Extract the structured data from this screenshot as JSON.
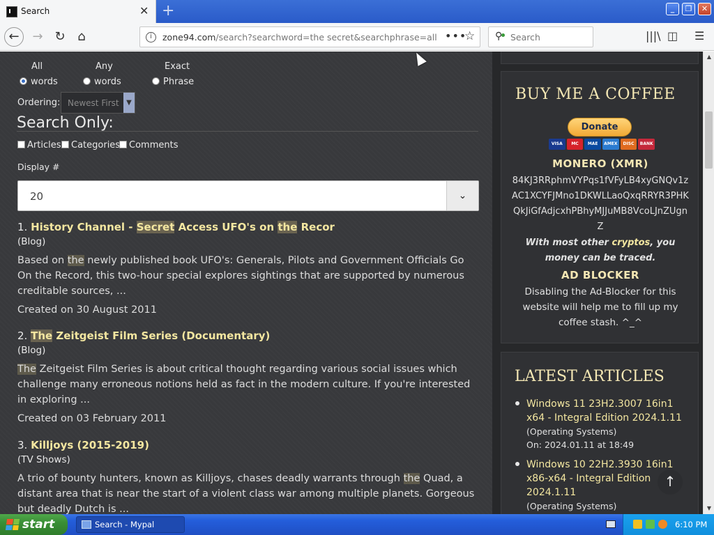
{
  "browser": {
    "tab_title": "Search",
    "tab_close": "✕",
    "new_tab": "+",
    "url_host": "zone94.com",
    "url_path": "/search?searchword=the secret&searchphrase=all",
    "search_placeholder": "Search",
    "window_controls": {
      "minimize": "_",
      "maximize": "❐",
      "close": "✕"
    }
  },
  "search_form": {
    "radios": [
      {
        "top": "All",
        "bottom": "words",
        "selected": true
      },
      {
        "top": "Any",
        "bottom": "words",
        "selected": false
      },
      {
        "top": "Exact",
        "bottom": "Phrase",
        "selected": false
      }
    ],
    "ordering_label": "Ordering:",
    "ordering_value": "Newest First",
    "search_only_heading": "Search Only:",
    "checkboxes": [
      "Articles",
      "Categories",
      "Comments"
    ],
    "display_label": "Display #",
    "display_value": "20"
  },
  "results": [
    {
      "number": "1.",
      "title_parts": [
        "History Channel",
        " - ",
        "Secret",
        " Access UFO's on ",
        "the",
        " Recor"
      ],
      "category": "(Blog)",
      "body_pre": "Based on ",
      "body_hl": "the",
      "body_post": " newly published book UFO's: Generals, Pilots and Government Officials Go On the Record, this two-hour special explores sightings that are supported by numerous creditable sources, ...",
      "date": "Created on 30 August 2011"
    },
    {
      "number": "2.",
      "title_hl": "The",
      "title_rest": " Zeitgeist Film Series (Documentary)",
      "category": "(Blog)",
      "body_hl": "The",
      "body_post": " Zeitgeist Film Series is about critical thought regarding various social issues which challenge many erroneous notions held as fact in the modern culture. If you're interested in exploring ...",
      "date": "Created on 03 February 2011"
    },
    {
      "number": "3.",
      "title": "Killjoys (2015-2019)",
      "category": "(TV Shows)",
      "body_pre": "A trio of bounty hunters, known as Killjoys, chases deadly warrants through ",
      "body_hl": "the",
      "body_post": " Quad, a distant area that is near the start of a violent class war among multiple planets. Gorgeous but deadly Dutch is ..."
    }
  ],
  "sidebar": {
    "coffee_title": "BUY ME A COFFEE",
    "donate_label": "Donate",
    "card_labels": [
      "VISA",
      "MC",
      "MAE",
      "AMEX",
      "DISC",
      "BANK"
    ],
    "monero_heading": "MONERO (XMR)",
    "monero_address": "84KJ3RRphmVYPqs1fVFyLB4xyGNQv1zAC1XCYFJMno1DKWLLaoQxqRRYR3PHKQkJiGfAdjcxhPBhyMJJuMB8VcoLJnZUgnZ",
    "crypto_pre": "With most other ",
    "crypto_link": "cryptos",
    "crypto_post": ", you money can be traced.",
    "adblock_heading": "AD BLOCKER",
    "adblock_text": "Disabling the Ad-Blocker for this website will help me to fill up my coffee stash. ^_^",
    "latest_title": "LATEST ARTICLES",
    "articles": [
      {
        "title": "Windows 11 23H2.3007 16in1 x64 - Integral Edition 2024.1.11",
        "category": "(Operating Systems)",
        "date": "On: 2024.01.11 at 18:49"
      },
      {
        "title": "Windows 10 22H2.3930 16in1 x86-x64 - Integral Edition 2024.1.11",
        "category": "(Operating Systems)"
      }
    ]
  },
  "taskbar": {
    "start_label": "start",
    "task_label": "Search - Mypal",
    "clock": "6:10 PM"
  },
  "colors": {
    "link_yellow": "#f3e6a0",
    "heading_cream": "#f4e7b4",
    "taskbar_blue": "#245edb"
  }
}
